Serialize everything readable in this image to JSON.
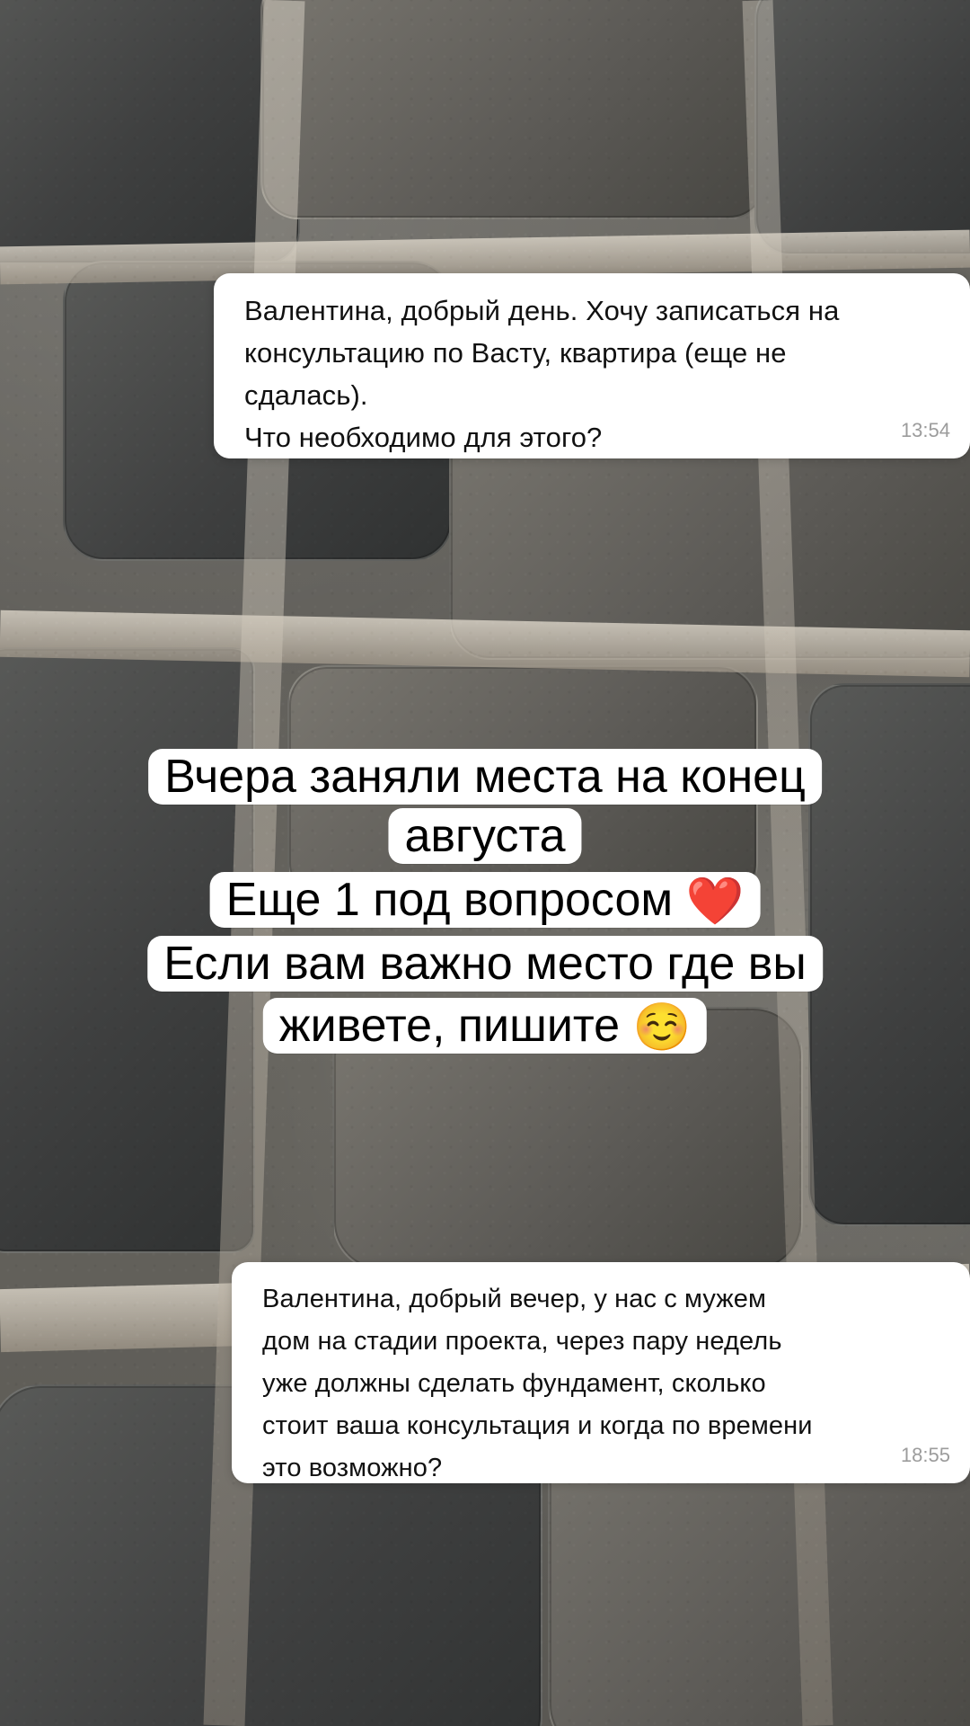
{
  "messages": [
    {
      "text": "Валентина, добрый день. Хочу записаться на\nконсультацию по Васту, квартира (еще не\nсдалась).\nЧто необходимо для этого?",
      "time": "13:54"
    },
    {
      "text": "Валентина, добрый вечер, у нас с мужем\nдом на стадии проекта, через пару недель\nуже должны сделать фундамент, сколько\nстоит ваша консультация и когда по времени\nэто возможно?",
      "time": "18:55"
    }
  ],
  "story": {
    "lines": [
      "Вчера заняли места на конец",
      "августа",
      "Еще 1 под вопросом",
      "Если вам важно место где вы",
      "живете, пишите"
    ],
    "heart_emoji": "❤️",
    "smile_emoji": "☺️"
  }
}
